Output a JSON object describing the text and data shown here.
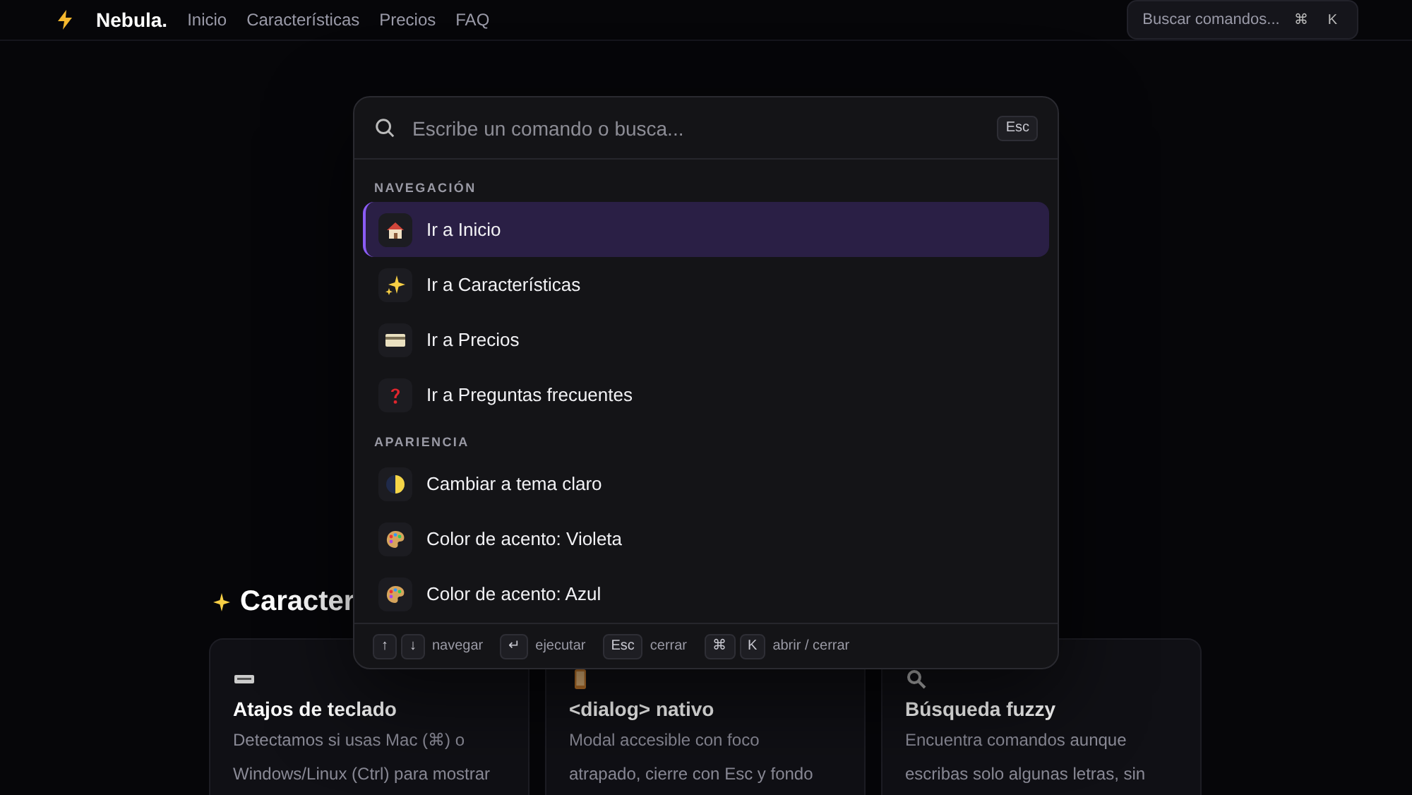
{
  "nav": {
    "brand": "Nebula.",
    "links": [
      "Inicio",
      "Características",
      "Precios",
      "FAQ"
    ],
    "search": {
      "label": "Buscar comandos...",
      "keys": [
        "⌘",
        "K"
      ]
    }
  },
  "section_heading": "Caracter",
  "cards": [
    {
      "title": "Atajos de teclado",
      "lines": [
        "Detectamos si usas Mac (⌘) o",
        "Windows/Linux (Ctrl) para mostrar"
      ]
    },
    {
      "title": "<dialog> nativo",
      "lines": [
        "Modal accesible con foco",
        "atrapado, cierre con Esc y fondo"
      ]
    },
    {
      "title": "Búsqueda fuzzy",
      "lines": [
        "Encuentra comandos aunque",
        "escribas solo algunas letras, sin"
      ]
    }
  ],
  "palette": {
    "search": {
      "placeholder": "Escribe un comando o busca...",
      "key": "Esc"
    },
    "groups": [
      {
        "label": "NAVEGACIÓN",
        "items": [
          {
            "label": "Ir a Inicio",
            "selected": true
          },
          {
            "label": "Ir a Características",
            "selected": false
          },
          {
            "label": "Ir a Precios",
            "selected": false
          },
          {
            "label": "Ir a Preguntas frecuentes",
            "selected": false
          }
        ]
      },
      {
        "label": "APARIENCIA",
        "items": [
          {
            "label": "Cambiar a tema claro",
            "selected": false
          },
          {
            "label": "Color de acento: Violeta",
            "selected": false
          },
          {
            "label": "Color de acento: Azul",
            "selected": false
          }
        ]
      }
    ],
    "footer": [
      {
        "keys": [
          "↑",
          "↓"
        ],
        "label": "navegar"
      },
      {
        "keys": [
          "↵"
        ],
        "label": "ejecutar"
      },
      {
        "keys": [
          "Esc"
        ],
        "label": "cerrar"
      },
      {
        "keys": [
          "⌘",
          "K"
        ],
        "label": "abrir / cerrar"
      }
    ]
  }
}
